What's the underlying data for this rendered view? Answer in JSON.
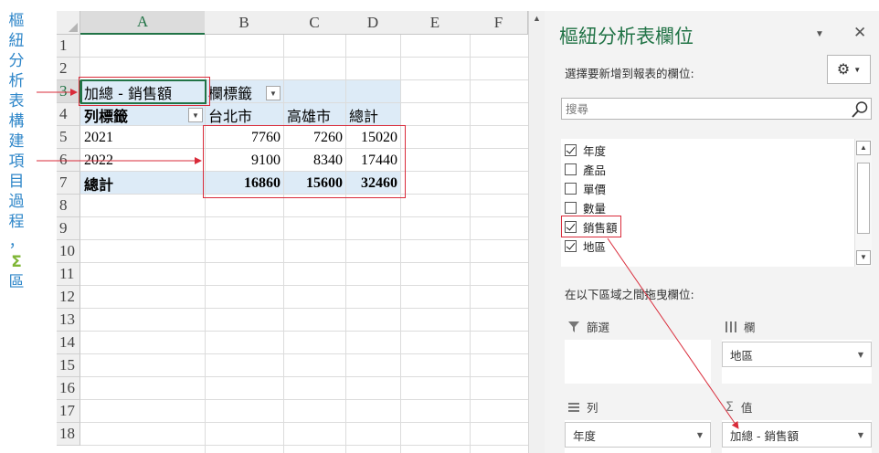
{
  "caption": {
    "chars": [
      "樞",
      "紐",
      "分",
      "析",
      "表",
      "構",
      "建",
      "項",
      "目",
      "過",
      "程",
      "，",
      "Σ",
      "區"
    ]
  },
  "sheet": {
    "columns": [
      "A",
      "B",
      "C",
      "D",
      "E",
      "F"
    ],
    "rows": [
      "1",
      "2",
      "3",
      "4",
      "5",
      "6",
      "7",
      "8",
      "9",
      "10",
      "11",
      "12",
      "13",
      "14",
      "15",
      "16",
      "17",
      "18"
    ],
    "pivot": {
      "value_header": "加總 - 銷售額",
      "col_label_header": "欄標籤",
      "row_label_header": "列標籤",
      "col_items": [
        "台北市",
        "高雄市",
        "總計"
      ],
      "rows": [
        {
          "label": "2021",
          "values": [
            "7760",
            "7260",
            "15020"
          ]
        },
        {
          "label": "2022",
          "values": [
            "9100",
            "8340",
            "17440"
          ]
        }
      ],
      "total": {
        "label": "總計",
        "values": [
          "16860",
          "15600",
          "32460"
        ]
      }
    }
  },
  "pane": {
    "title": "樞紐分析表欄位",
    "subtitle": "選擇要新增到報表的欄位:",
    "search_placeholder": "搜尋",
    "fields": [
      {
        "label": "年度",
        "checked": true
      },
      {
        "label": "產品",
        "checked": false
      },
      {
        "label": "單價",
        "checked": false
      },
      {
        "label": "數量",
        "checked": false
      },
      {
        "label": "銷售額",
        "checked": true
      },
      {
        "label": "地區",
        "checked": true
      }
    ],
    "drag_label": "在以下區域之間拖曳欄位:",
    "areas": {
      "filter": {
        "title": "篩選"
      },
      "columns": {
        "title": "欄",
        "item": "地區"
      },
      "rows": {
        "title": "列",
        "item": "年度"
      },
      "values": {
        "title": "值",
        "item": "加總 - 銷售額"
      }
    }
  },
  "colors": {
    "accent_green": "#217346",
    "caption_blue": "#2e86c9",
    "sigma_green": "#7fb636",
    "pivot_band": "#ddebf7",
    "annotation_red": "#d92b3a"
  }
}
